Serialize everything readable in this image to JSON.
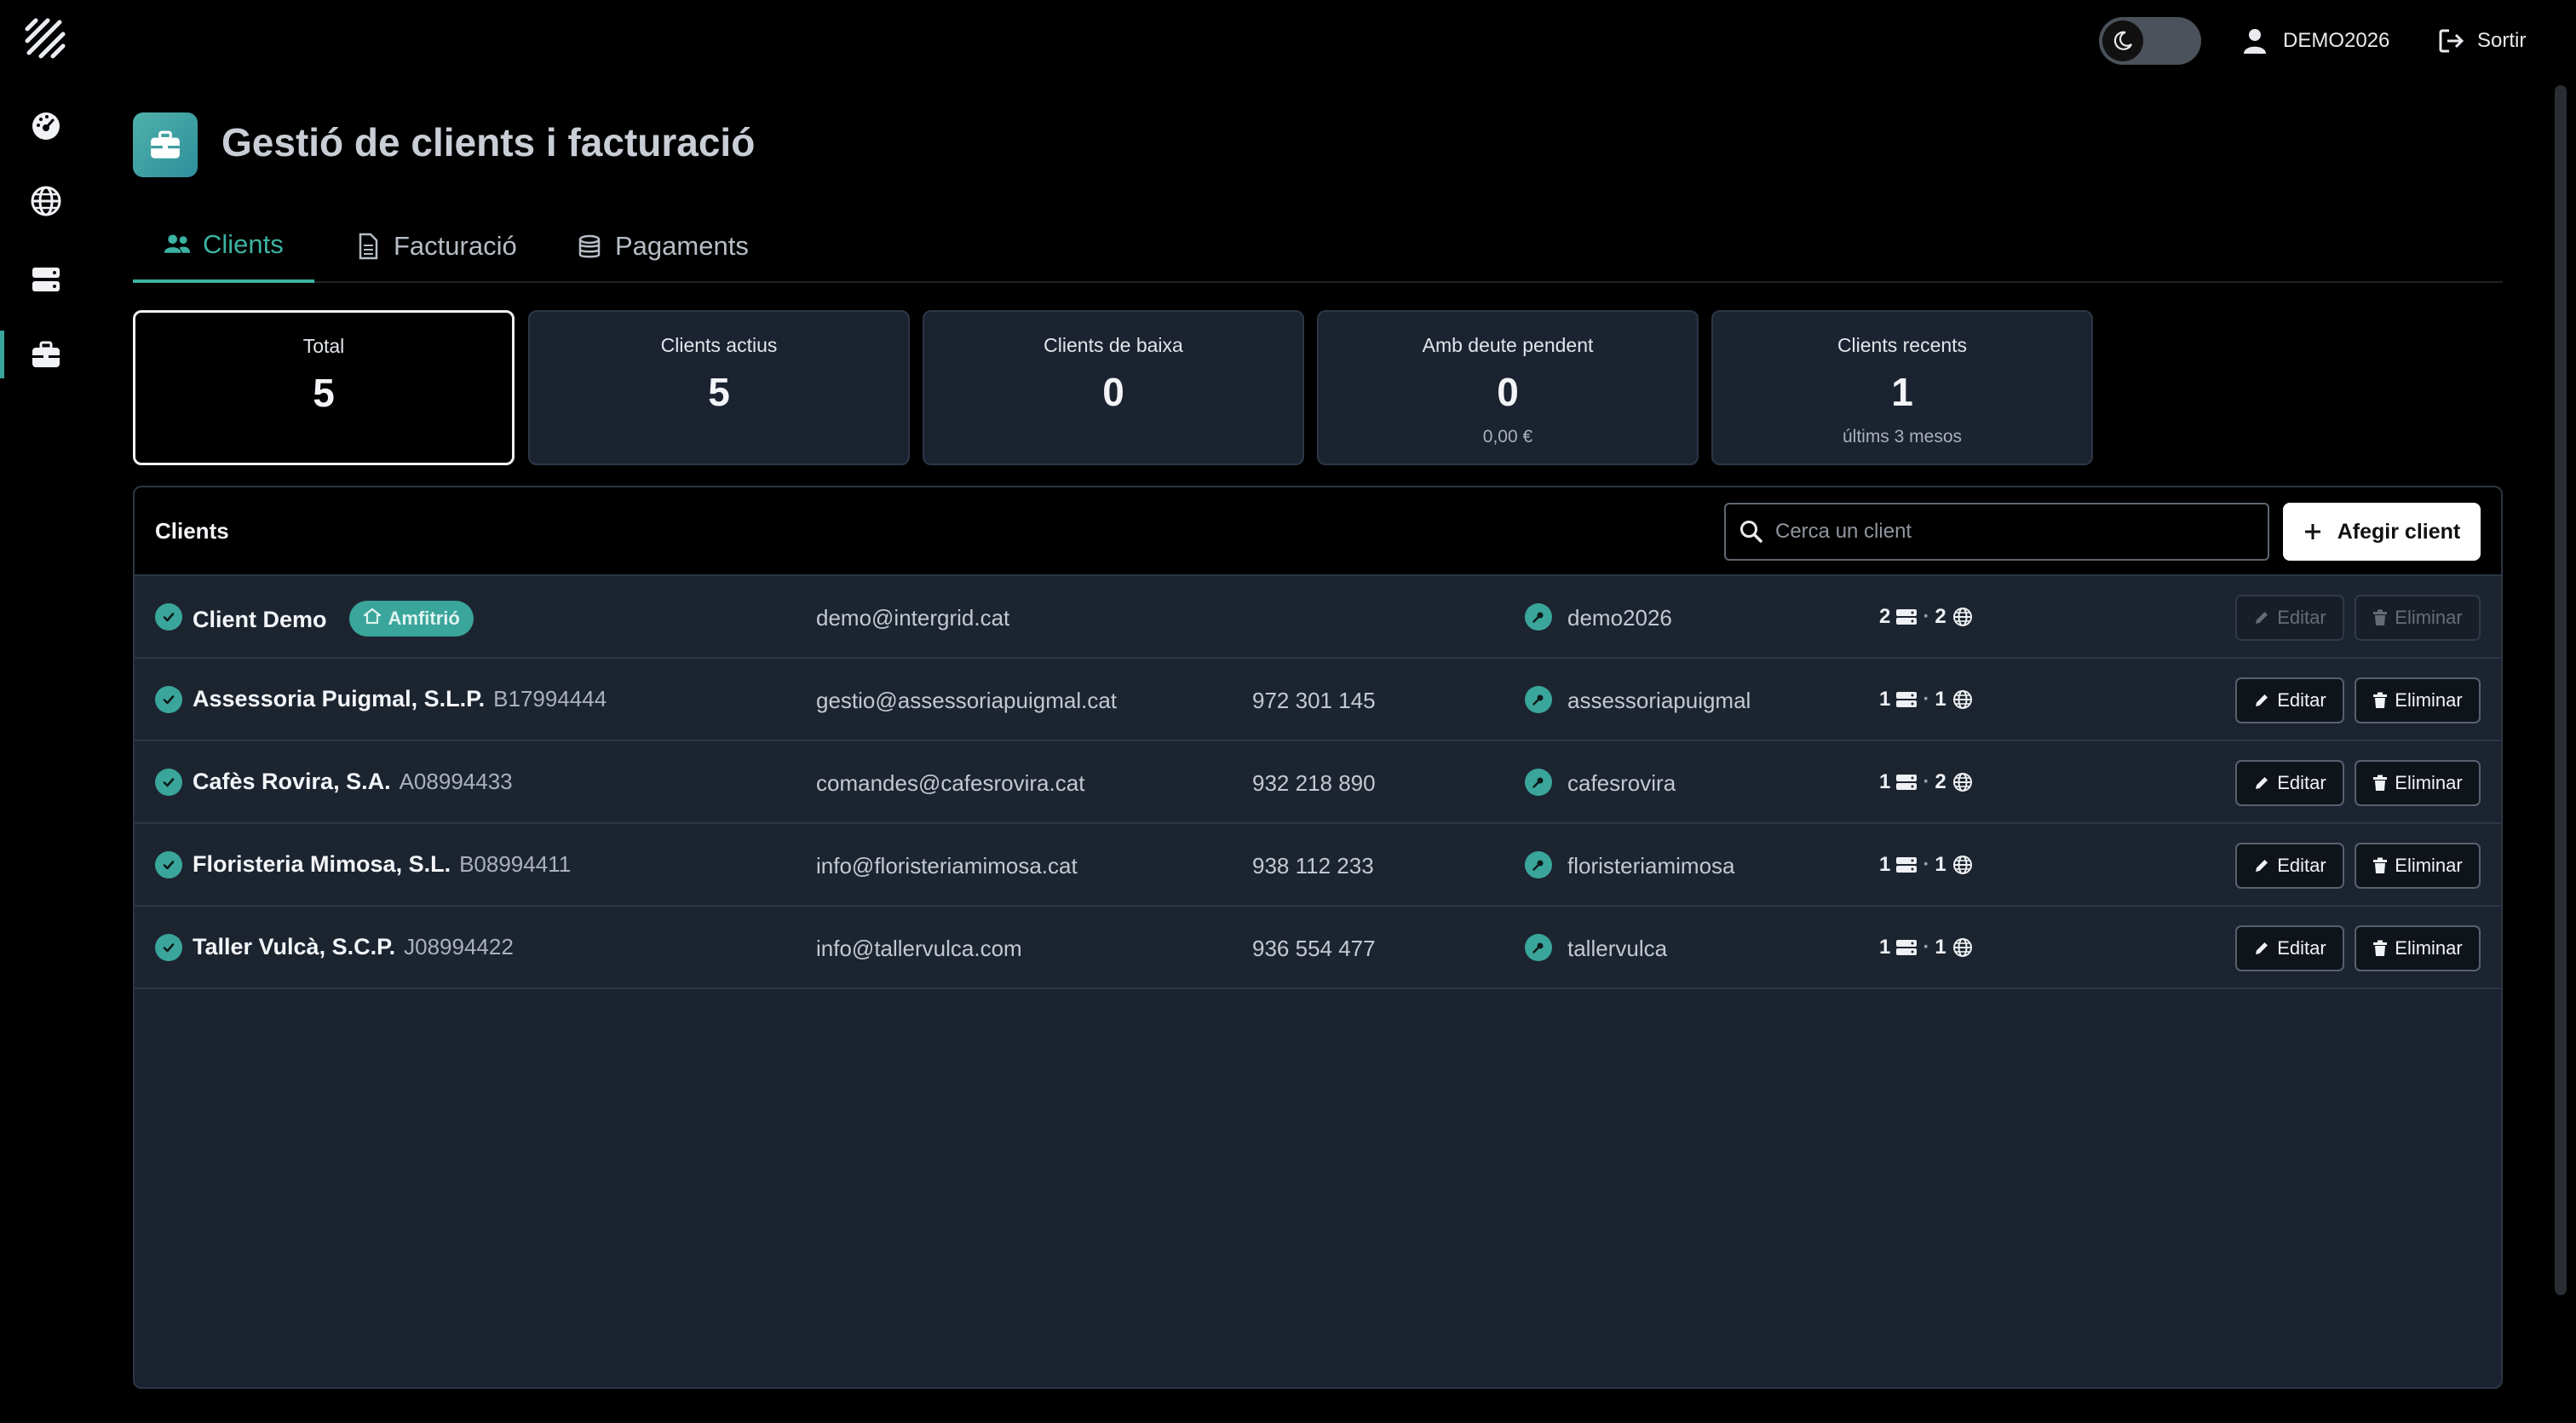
{
  "topbar": {
    "username": "DEMO2026",
    "logout_label": "Sortir"
  },
  "page": {
    "title": "Gestió de clients i facturació"
  },
  "tabs": [
    {
      "label": "Clients",
      "icon": "users-icon",
      "active": true
    },
    {
      "label": "Facturació",
      "icon": "document-icon",
      "active": false
    },
    {
      "label": "Pagaments",
      "icon": "coins-icon",
      "active": false
    }
  ],
  "stats": [
    {
      "label": "Total",
      "value": "5",
      "sub": ""
    },
    {
      "label": "Clients actius",
      "value": "5",
      "sub": ""
    },
    {
      "label": "Clients de baixa",
      "value": "0",
      "sub": ""
    },
    {
      "label": "Amb deute pendent",
      "value": "0",
      "sub": "0,00 €"
    },
    {
      "label": "Clients recents",
      "value": "1",
      "sub": "últims 3 mesos"
    }
  ],
  "clients_panel": {
    "title": "Clients",
    "search_placeholder": "Cerca un client",
    "add_label": "Afegir client",
    "edit_label": "Editar",
    "delete_label": "Eliminar",
    "host_badge": "Amfitrió",
    "rows": [
      {
        "name": "Client Demo",
        "nif": "",
        "host": true,
        "email": "demo@intergrid.cat",
        "phone": "",
        "username": "demo2026",
        "servers": "2",
        "domains": "2",
        "actions_disabled": true
      },
      {
        "name": "Assessoria Puigmal, S.L.P.",
        "nif": "B17994444",
        "host": false,
        "email": "gestio@assessoriapuigmal.cat",
        "phone": "972 301 145",
        "username": "assessoriapuigmal",
        "servers": "1",
        "domains": "1",
        "actions_disabled": false
      },
      {
        "name": "Cafès Rovira, S.A.",
        "nif": "A08994433",
        "host": false,
        "email": "comandes@cafesrovira.cat",
        "phone": "932 218 890",
        "username": "cafesrovira",
        "servers": "1",
        "domains": "2",
        "actions_disabled": false
      },
      {
        "name": "Floristeria Mimosa, S.L.",
        "nif": "B08994411",
        "host": false,
        "email": "info@floristeriamimosa.cat",
        "phone": "938 112 233",
        "username": "floristeriamimosa",
        "servers": "1",
        "domains": "1",
        "actions_disabled": false
      },
      {
        "name": "Taller Vulcà, S.C.P.",
        "nif": "J08994422",
        "host": false,
        "email": "info@tallervulca.com",
        "phone": "936 554 477",
        "username": "tallervulca",
        "servers": "1",
        "domains": "1",
        "actions_disabled": false
      }
    ]
  },
  "colors": {
    "accent": "#3aa59a",
    "panel": "#1b2330",
    "background": "#000000"
  }
}
